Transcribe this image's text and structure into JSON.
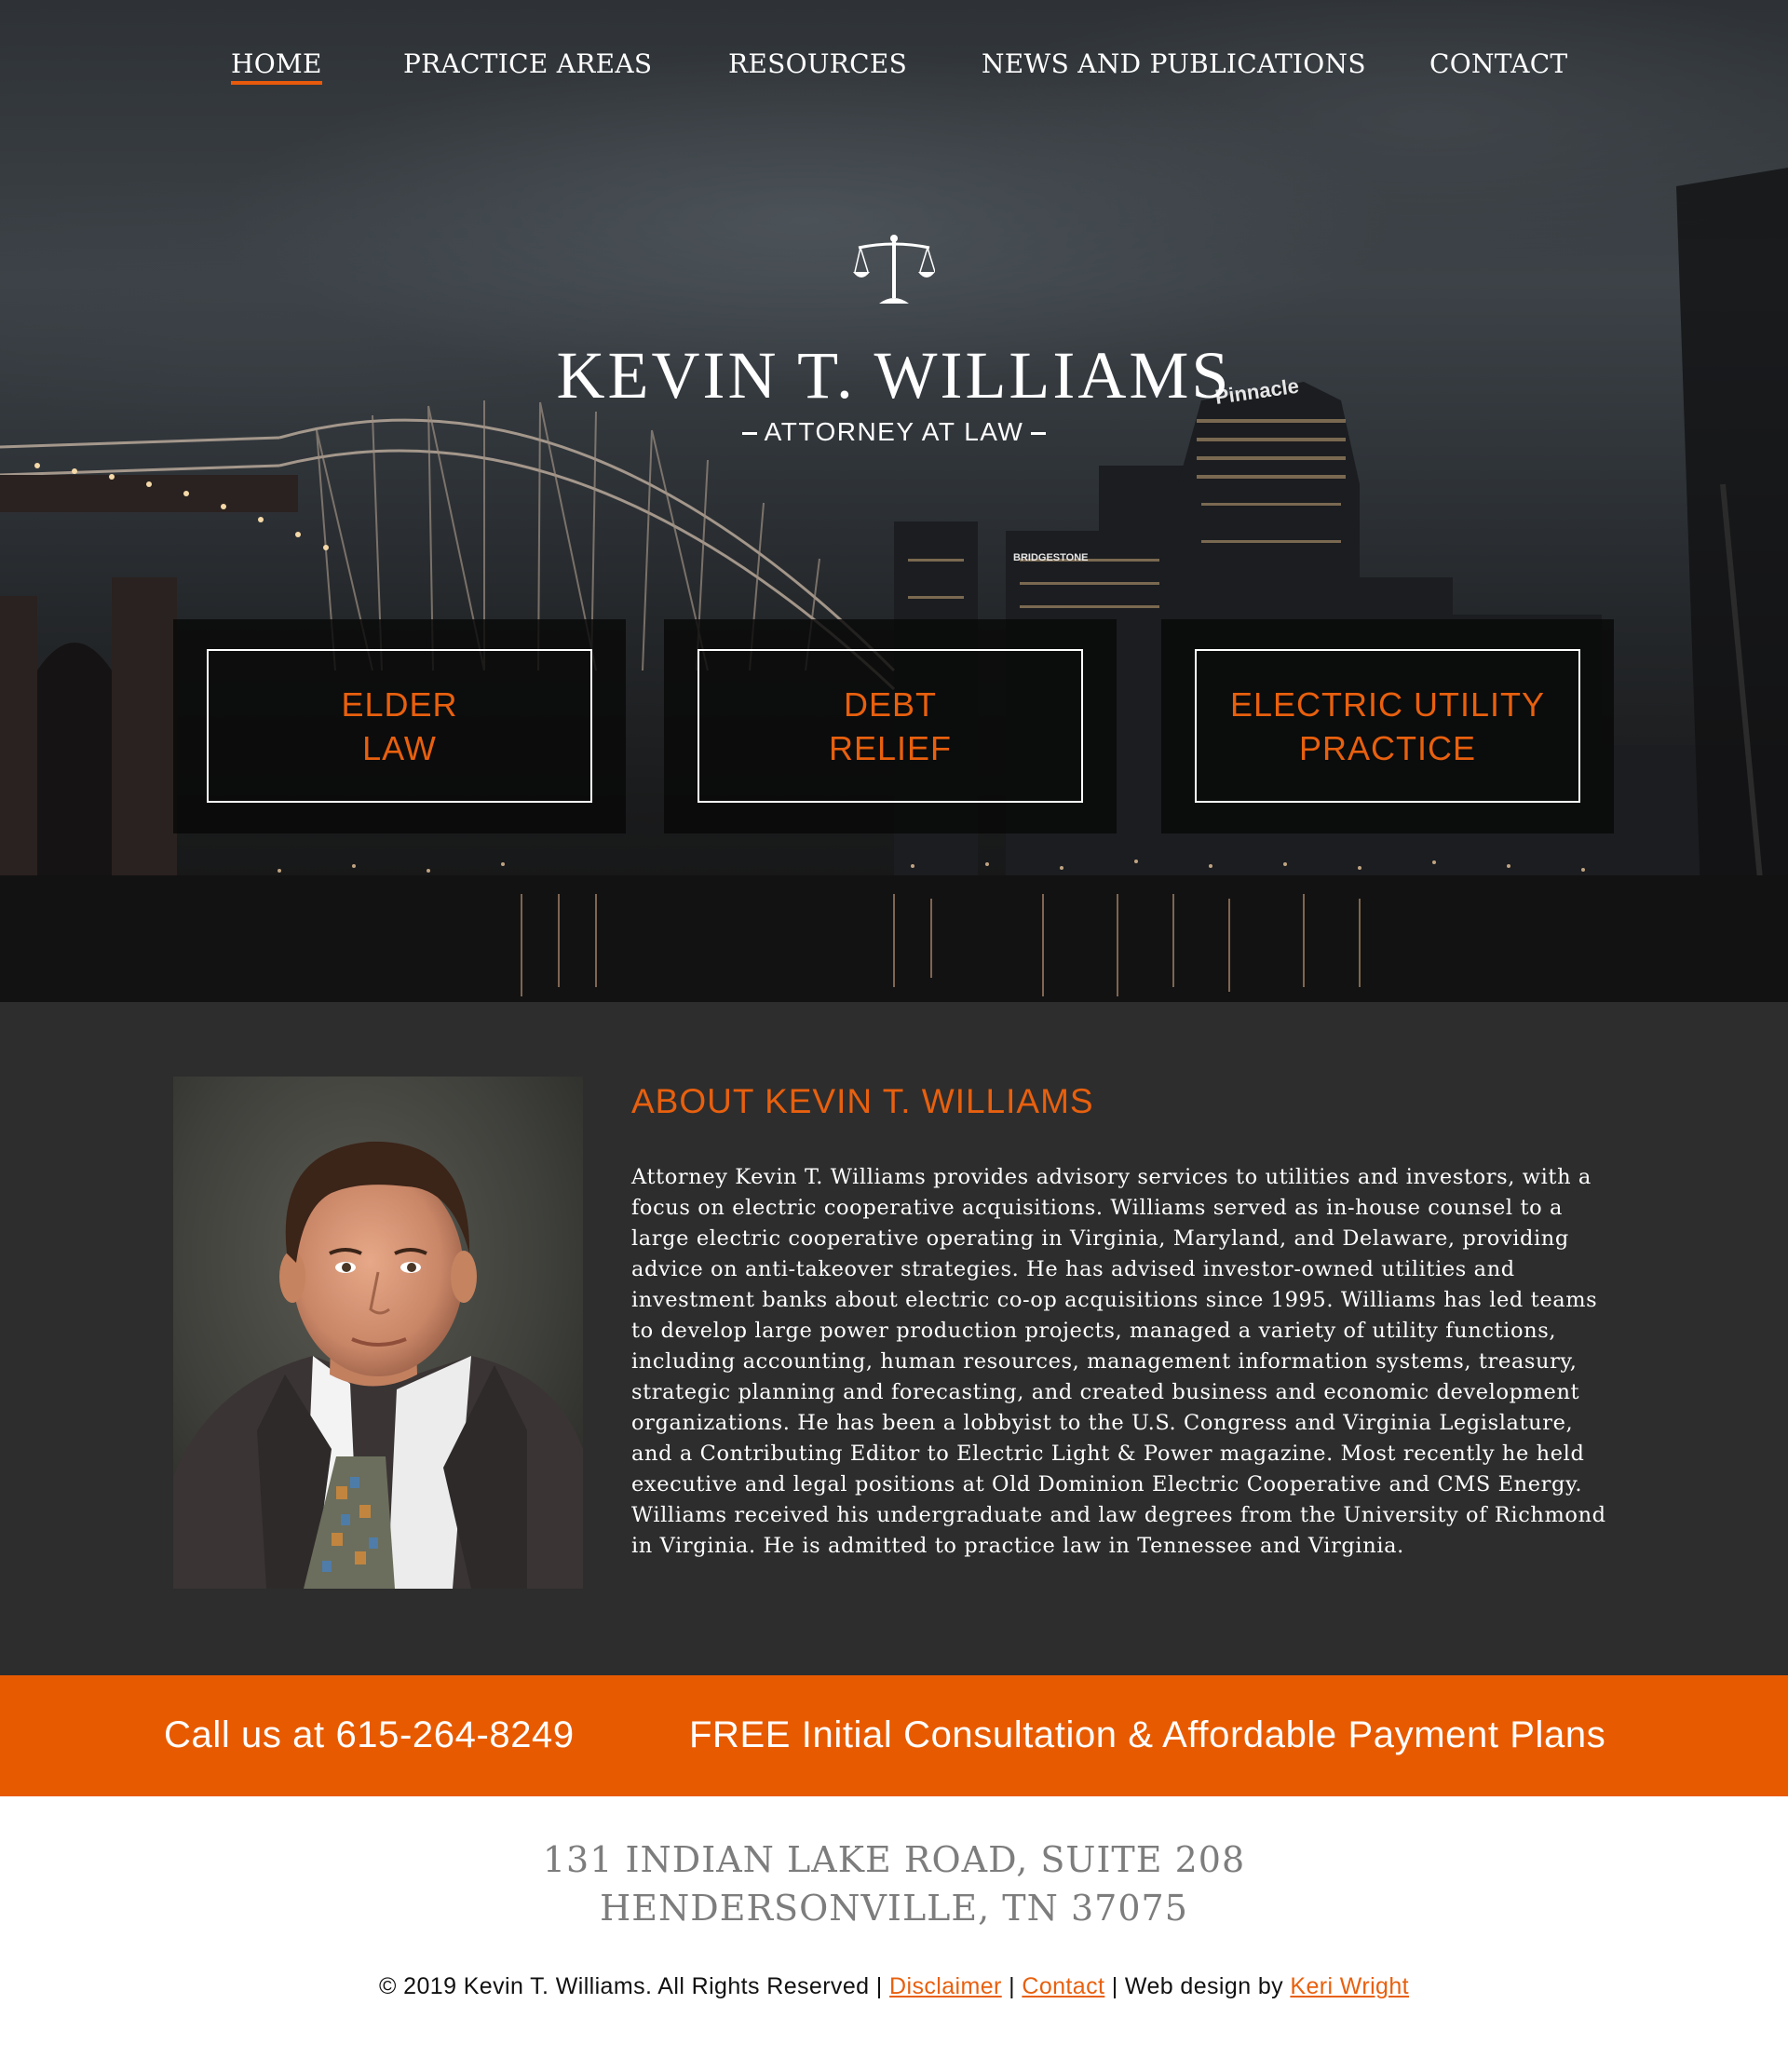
{
  "nav": {
    "items": [
      {
        "label": "HOME",
        "active": true
      },
      {
        "label": "PRACTICE AREAS",
        "active": false
      },
      {
        "label": "RESOURCES",
        "active": false
      },
      {
        "label": "NEWS AND PUBLICATIONS",
        "active": false
      },
      {
        "label": "CONTACT",
        "active": false
      }
    ]
  },
  "hero": {
    "logo_icon": "scales-of-justice-icon",
    "name": "KEVIN T. WILLIAMS",
    "subtitle": "ATTORNEY AT LAW",
    "sign_text_1": "Pinnacle",
    "sign_text_2": "BRIDGESTONE",
    "practice_areas": [
      {
        "line1": "ELDER",
        "line2": "LAW"
      },
      {
        "line1": "DEBT",
        "line2": "RELIEF"
      },
      {
        "line1": "ELECTRIC UTILITY",
        "line2": "PRACTICE"
      }
    ]
  },
  "about": {
    "heading": "ABOUT KEVIN T. WILLIAMS",
    "body": "Attorney Kevin T. Williams provides advisory services to utilities and investors, with a focus on electric cooperative acquisitions. Williams served as in-house counsel to a large electric cooperative operating in Virginia, Maryland, and Delaware, providing advice on anti-takeover strategies. He has advised investor-owned utilities and investment banks about electric co-op acquisitions since 1995. Williams has led teams to develop large power production projects, managed a variety of utility functions, including accounting, human resources, management information systems, treasury, strategic planning and forecasting, and created business and economic development organizations. He has been a lobbyist to the U.S. Congress and Virginia Legislature, and a Contributing Editor to Electric Light & Power magazine. Most recently he held executive and legal positions at Old Dominion Electric Cooperative and CMS Energy. Williams received his undergraduate and law degrees from the University of Richmond in Virginia. He is admitted to practice law in Tennessee and Virginia."
  },
  "cta": {
    "phone": "Call us at 615-264-8249",
    "offer": "FREE Initial Consultation & Affordable Payment Plans"
  },
  "footer": {
    "address_line1": "131 INDIAN LAKE ROAD, SUITE 208",
    "address_line2": "HENDERSONVILLE, TN 37075",
    "copyright": "© 2019 Kevin T. Williams. All Rights Reserved |",
    "sep": "|",
    "web_design_by": "| Web design by",
    "links": {
      "disclaimer": "Disclaimer",
      "contact": "Contact",
      "designer": "Keri Wright"
    }
  },
  "colors": {
    "accent": "#e85a00",
    "about_bg": "#2d2d2d",
    "address_gray": "#7d7d7d"
  }
}
